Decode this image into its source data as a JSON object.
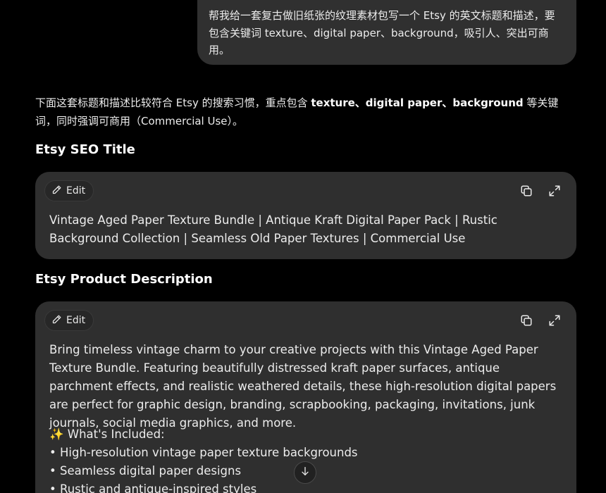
{
  "user_message": {
    "text": "帮我给一套复古做旧纸张的纹理素材包写一个 Etsy 的英文标题和描述，要包含关键词 texture、digital paper、background，吸引人、突出可商用。"
  },
  "response": {
    "intro_before": "下面这套标题和描述比较符合 Etsy 的搜索习惯，重点包含 ",
    "intro_keywords": "texture、digital paper、background",
    "intro_after": " 等关键词，同时强调可商用（Commercial Use）。",
    "seo_title_heading": "Etsy SEO Title",
    "description_heading": "Etsy Product Description"
  },
  "title_card": {
    "edit_label": "Edit",
    "text": "Vintage Aged Paper Texture Bundle | Antique Kraft Digital Paper Pack | Rustic Background Collection | Seamless Old Paper Textures | Commercial Use"
  },
  "description_card": {
    "edit_label": "Edit",
    "paragraph": "Bring timeless vintage charm to your creative projects with this Vintage Aged Paper Texture Bundle. Featuring beautifully distressed kraft paper surfaces, antique parchment effects, and realistic weathered details, these high-resolution digital papers are perfect for graphic design, branding, scrapbooking, packaging, invitations, junk journals, social media graphics, and more.",
    "included_heading": "✨ What's Included:",
    "included_items": [
      "• High-resolution vintage paper texture backgrounds",
      "• Seamless digital paper designs",
      "• Rustic and antique-inspired styles"
    ]
  },
  "icons": {
    "edit": "pencil-icon",
    "copy": "copy-icon",
    "expand": "expand-icon",
    "scroll": "arrow-down-icon"
  },
  "colors": {
    "background": "#000000",
    "bubble": "#303030",
    "card": "#2f2f2f",
    "text": "#ececec"
  }
}
